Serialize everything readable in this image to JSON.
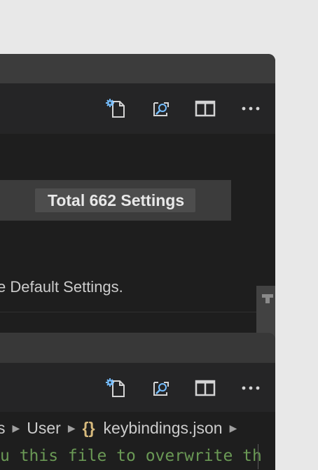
{
  "settings_editor": {
    "total_settings_label": "Total 662 Settings",
    "hint_text": "e Default Settings.",
    "actions": [
      "open-settings-json-icon",
      "find-in-file-icon",
      "split-editor-icon",
      "more-actions-icon"
    ]
  },
  "keybindings_editor": {
    "breadcrumb": {
      "part_partial": "s",
      "user": "User",
      "braces": "{}",
      "file": "keybindings.json"
    },
    "code_line": "u this file to overwrite th",
    "actions": [
      "open-settings-json-icon",
      "find-in-file-icon",
      "split-editor-icon",
      "more-actions-icon"
    ]
  },
  "colors": {
    "editor_bg": "#1e1e1e",
    "titlebar_bg": "#3c3c3c",
    "comment_green": "#6a9955",
    "json_braces": "#d7ba7d"
  }
}
